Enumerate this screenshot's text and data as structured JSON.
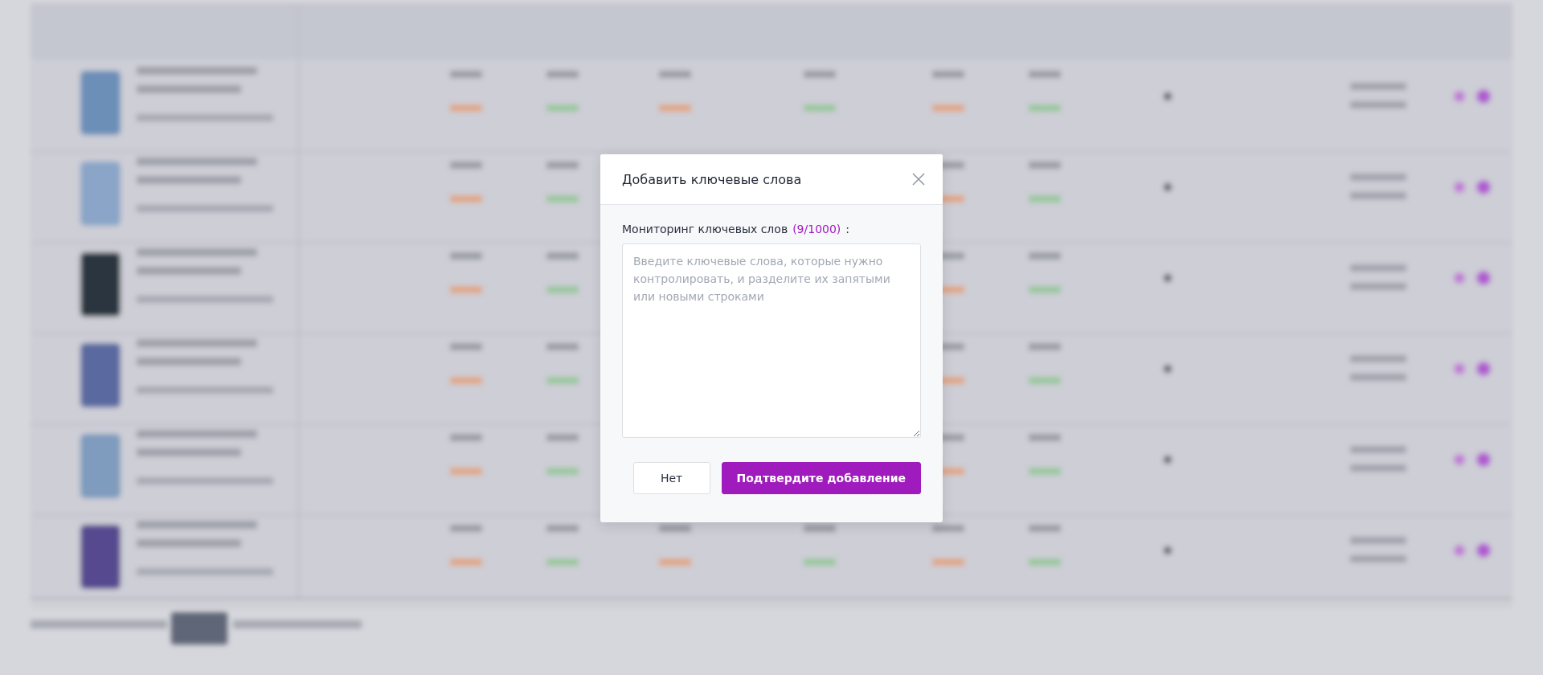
{
  "dialog": {
    "title": "Добавить ключевые слова",
    "field_label": "Мониторинг ключевых слов",
    "counter": "(9/1000)",
    "label_suffix": ":",
    "placeholder": "Введите ключевые слова, которые нужно контролировать, и разделите их запятыми или новыми строками",
    "buttons": [
      {
        "label": "Нет",
        "kind": "secondary"
      },
      {
        "label": "Подтвердите добавление",
        "kind": "primary"
      }
    ]
  }
}
